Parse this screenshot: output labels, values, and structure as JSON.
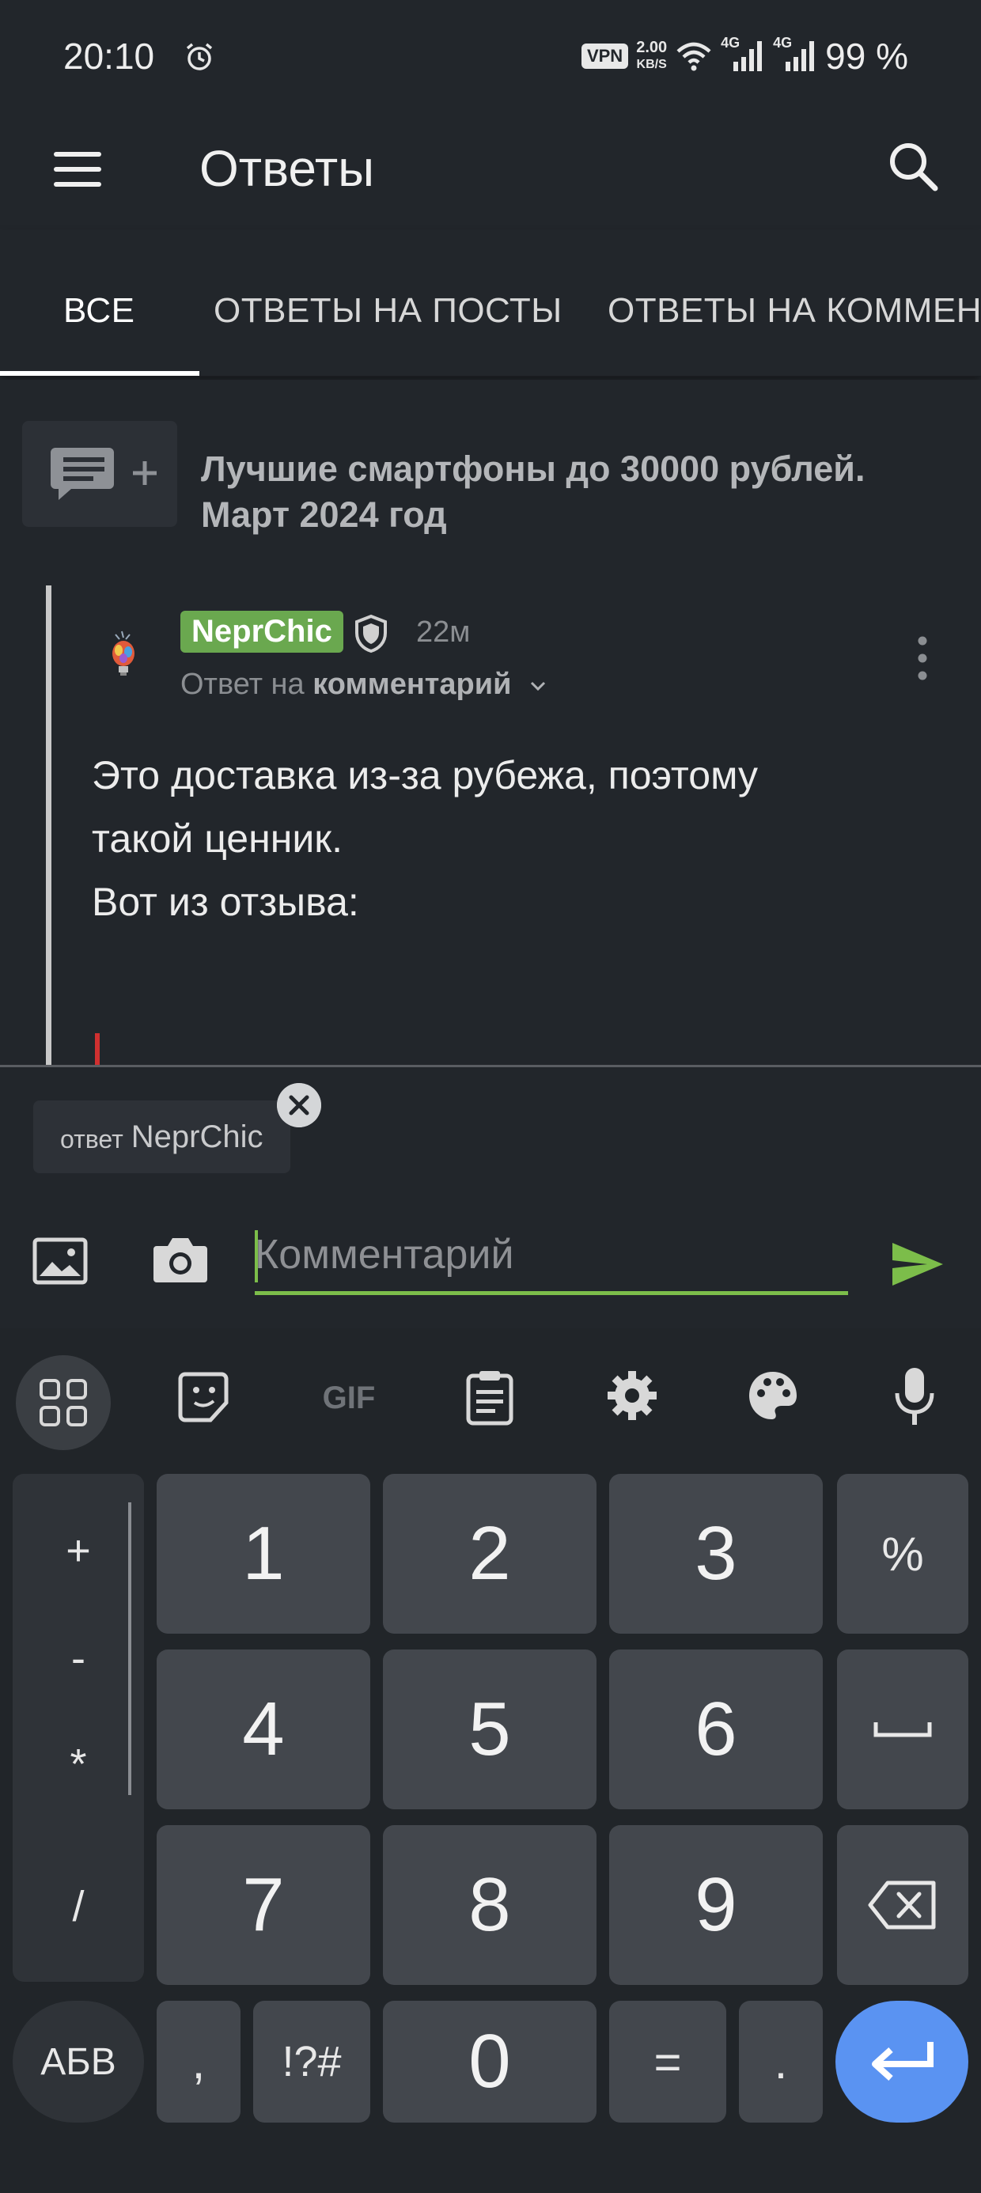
{
  "status_bar": {
    "time": "20:10",
    "alarm_icon": "alarm-icon",
    "vpn_label": "VPN",
    "speed_value": "2.00",
    "speed_unit": "KB/S",
    "network_label_1": "4G",
    "network_label_2": "4G",
    "battery": "99 %"
  },
  "app_bar": {
    "title": "Ответы",
    "menu_icon": "menu-icon",
    "search_icon": "search-icon"
  },
  "tabs": [
    {
      "label": "ВСЕ",
      "active": true
    },
    {
      "label": "ОТВЕТЫ НА ПОСТЫ",
      "active": false
    },
    {
      "label": "ОТВЕТЫ НА КОММЕНТАРИИ",
      "active": false
    }
  ],
  "post": {
    "title": "Лучшие смартфоны до 30000 рублей. Март 2024 год",
    "icon": "comment-add-icon"
  },
  "comment": {
    "author": "NeprChic",
    "time_ago": "22м",
    "reply_prefix": "Ответ на",
    "reply_target": "комментарий",
    "text_lines": [
      "Это доставка из-за рубежа, поэтому",
      "такой ценник.",
      "Вот из отзыва:"
    ]
  },
  "reply_box": {
    "chip_prefix": "ответ",
    "chip_name": "NeprChic",
    "placeholder": "Комментарий",
    "value": ""
  },
  "keyboard": {
    "toolbar_icons": [
      "apps-icon",
      "sticker-icon",
      "gif-icon",
      "clipboard-icon",
      "settings-icon",
      "palette-icon",
      "mic-icon"
    ],
    "gif_label": "GIF",
    "side_symbols": [
      "+",
      "-",
      "*",
      "/"
    ],
    "digit_rows": [
      [
        "1",
        "2",
        "3"
      ],
      [
        "4",
        "5",
        "6"
      ],
      [
        "7",
        "8",
        "9"
      ]
    ],
    "right_keys": [
      "%"
    ],
    "bottom_row": {
      "abc": "АБВ",
      "comma": ",",
      "symbols": "!?#",
      "zero": "0",
      "equals": "=",
      "dot": "."
    }
  },
  "colors": {
    "background": "#22262b",
    "accent_green": "#6aa84f",
    "enter_blue": "#5a93f2",
    "key": "#43474d"
  }
}
